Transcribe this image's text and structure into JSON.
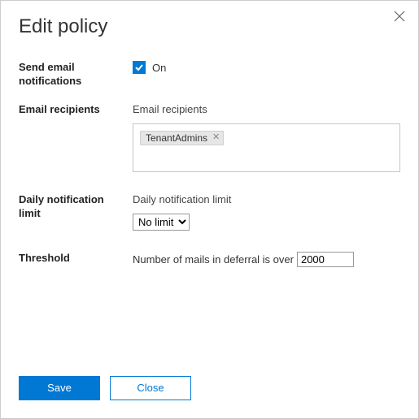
{
  "dialog": {
    "title": "Edit policy"
  },
  "fields": {
    "sendEmail": {
      "label": "Send email notifications",
      "checked": true,
      "text": "On"
    },
    "recipients": {
      "label": "Email recipients",
      "sublabel": "Email recipients",
      "tags": [
        "TenantAdmins"
      ]
    },
    "dailyLimit": {
      "label": "Daily notification limit",
      "sublabel": "Daily notification limit",
      "selected": "No limit"
    },
    "threshold": {
      "label": "Threshold",
      "prefix": "Number of mails in deferral is over",
      "value": "2000"
    }
  },
  "buttons": {
    "save": "Save",
    "close": "Close"
  }
}
